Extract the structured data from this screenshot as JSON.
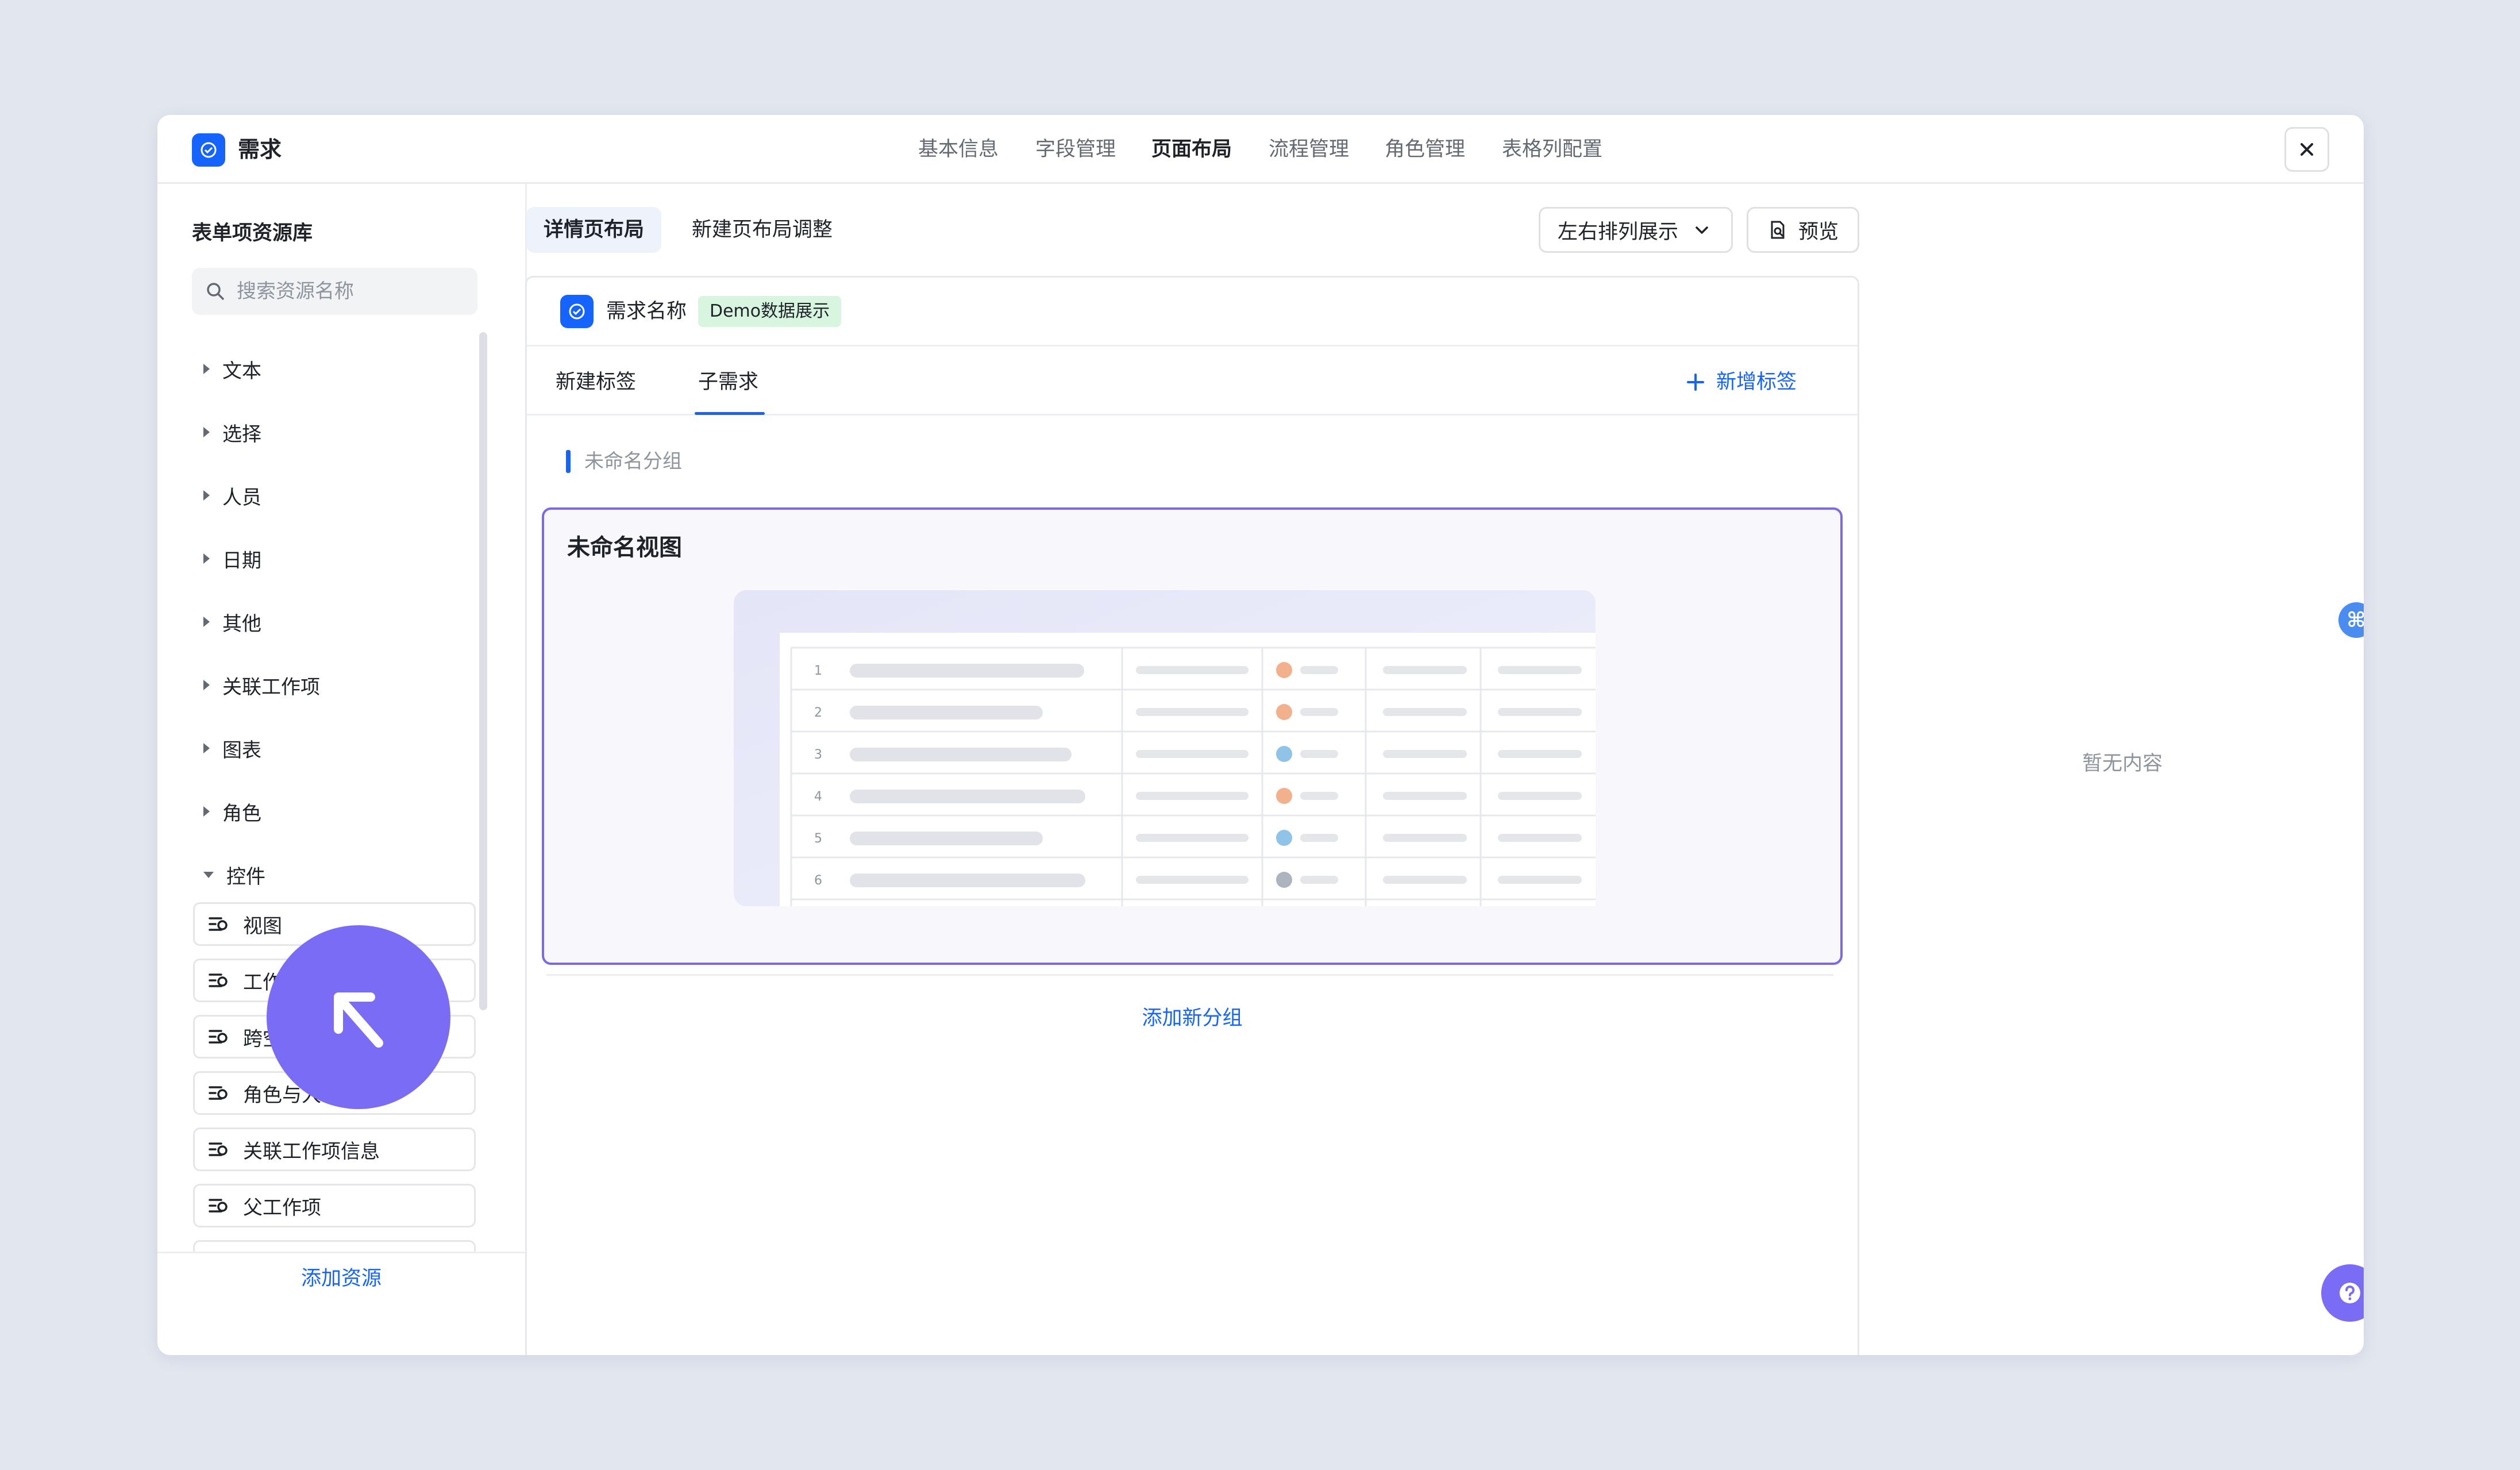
{
  "app": {
    "title": "需求",
    "close_icon": "close-icon"
  },
  "nav_tabs": [
    {
      "label": "基本信息",
      "active": false
    },
    {
      "label": "字段管理",
      "active": false
    },
    {
      "label": "页面布局",
      "active": true
    },
    {
      "label": "流程管理",
      "active": false
    },
    {
      "label": "角色管理",
      "active": false
    },
    {
      "label": "表格列配置",
      "active": false
    }
  ],
  "sidebar": {
    "title": "表单项资源库",
    "search": {
      "placeholder": "搜索资源名称",
      "value": ""
    },
    "categories": [
      {
        "label": "文本",
        "expanded": false
      },
      {
        "label": "选择",
        "expanded": false
      },
      {
        "label": "人员",
        "expanded": false
      },
      {
        "label": "日期",
        "expanded": false
      },
      {
        "label": "其他",
        "expanded": false
      },
      {
        "label": "关联工作项",
        "expanded": false
      },
      {
        "label": "图表",
        "expanded": false
      },
      {
        "label": "角色",
        "expanded": false
      },
      {
        "label": "控件",
        "expanded": true
      }
    ],
    "controls": [
      {
        "label": "视图"
      },
      {
        "label": "工作"
      },
      {
        "label": "跨空"
      },
      {
        "label": "角色与人"
      },
      {
        "label": "关联工作项信息"
      },
      {
        "label": "父工作项"
      }
    ],
    "footer_action": "添加资源"
  },
  "layout_tabs": [
    {
      "label": "详情页布局",
      "active": true
    },
    {
      "label": "新建页布局调整",
      "active": false
    }
  ],
  "arrangement": {
    "selected": "左右排列展示"
  },
  "preview_label": "预览",
  "card": {
    "requirement_name": "需求名称",
    "demo_tag": "Demo数据展示",
    "tabs": [
      {
        "label": "新建标签",
        "active": false
      },
      {
        "label": "子需求",
        "active": true
      }
    ],
    "add_tag_label": "新增标签",
    "group_name": "未命名分组",
    "view_title": "未命名视图",
    "table_rows": [
      {
        "n": "1"
      },
      {
        "n": "2"
      },
      {
        "n": "3"
      },
      {
        "n": "4"
      },
      {
        "n": "5"
      },
      {
        "n": "6"
      }
    ],
    "add_group_label": "添加新分组"
  },
  "right_panel": {
    "empty_text": "暂无内容"
  },
  "colors": {
    "accent": "#1664ff",
    "highlight": "#7b69e8",
    "cursor": "#7b6cf6",
    "tag_bg": "#d8f5df"
  }
}
